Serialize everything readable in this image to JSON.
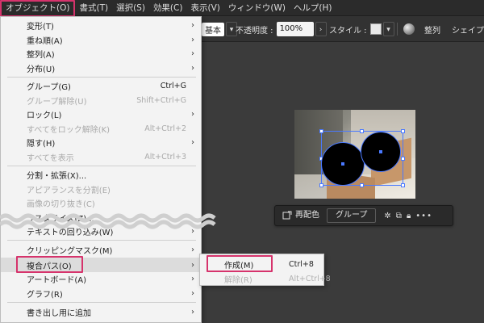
{
  "menubar": {
    "items": [
      "オブジェクト(O)",
      "書式(T)",
      "選択(S)",
      "効果(C)",
      "表示(V)",
      "ウィンドウ(W)",
      "ヘルプ(H)"
    ]
  },
  "toolbar": {
    "style_prefix": "基本",
    "opacity_label": "不透明度 :",
    "opacity_value": "100%",
    "style_label": "スタイル :",
    "align_label": "整列",
    "shape_label": "シェイプ"
  },
  "object_menu": {
    "items": [
      {
        "label": "変形(T)",
        "shortcut": "",
        "submenu": true,
        "disabled": false
      },
      {
        "label": "重ね順(A)",
        "shortcut": "",
        "submenu": true,
        "disabled": false
      },
      {
        "label": "整列(A)",
        "shortcut": "",
        "submenu": true,
        "disabled": false
      },
      {
        "label": "分布(U)",
        "shortcut": "",
        "submenu": true,
        "disabled": false
      },
      {
        "label": "グループ(G)",
        "shortcut": "Ctrl+G",
        "submenu": false,
        "disabled": false
      },
      {
        "label": "グループ解除(U)",
        "shortcut": "Shift+Ctrl+G",
        "submenu": false,
        "disabled": true
      },
      {
        "label": "ロック(L)",
        "shortcut": "",
        "submenu": true,
        "disabled": false
      },
      {
        "label": "すべてをロック解除(K)",
        "shortcut": "Alt+Ctrl+2",
        "submenu": false,
        "disabled": true
      },
      {
        "label": "隠す(H)",
        "shortcut": "",
        "submenu": true,
        "disabled": false
      },
      {
        "label": "すべてを表示",
        "shortcut": "Alt+Ctrl+3",
        "submenu": false,
        "disabled": true
      },
      {
        "label": "分割・拡張(X)...",
        "shortcut": "",
        "submenu": false,
        "disabled": false
      },
      {
        "label": "アピアランスを分割(E)",
        "shortcut": "",
        "submenu": false,
        "disabled": true
      },
      {
        "label": "画像の切り抜き(C)",
        "shortcut": "",
        "submenu": false,
        "disabled": true
      },
      {
        "label": "ラスタライズ(Z)...",
        "shortcut": "",
        "submenu": false,
        "disabled": false
      },
      {
        "label": "テキストの回り込み(W)",
        "shortcut": "",
        "submenu": true,
        "disabled": false
      },
      {
        "label": "クリッピングマスク(M)",
        "shortcut": "",
        "submenu": true,
        "disabled": false
      },
      {
        "label": "複合パス(O)",
        "shortcut": "",
        "submenu": true,
        "disabled": false
      },
      {
        "label": "アートボード(A)",
        "shortcut": "",
        "submenu": true,
        "disabled": false
      },
      {
        "label": "グラフ(R)",
        "shortcut": "",
        "submenu": true,
        "disabled": false
      },
      {
        "label": "書き出し用に追加",
        "shortcut": "",
        "submenu": true,
        "disabled": false
      }
    ]
  },
  "compound_path_submenu": {
    "items": [
      {
        "label": "作成(M)",
        "shortcut": "Ctrl+8",
        "disabled": false
      },
      {
        "label": "解除(R)",
        "shortcut": "Alt+Ctrl+8",
        "disabled": true
      }
    ]
  },
  "context_bar": {
    "recolor_label": "再配色",
    "group_label": "グループ"
  },
  "icons": {
    "chevron": "chevron-down-icon",
    "submenu_arrow": "chevron-right-icon",
    "globe": "globe-icon",
    "recolor": "recolor-icon",
    "more": "more-icon",
    "lock": "lock-icon"
  },
  "colors": {
    "highlight": "#d6336c",
    "selection": "#4a79ff"
  }
}
